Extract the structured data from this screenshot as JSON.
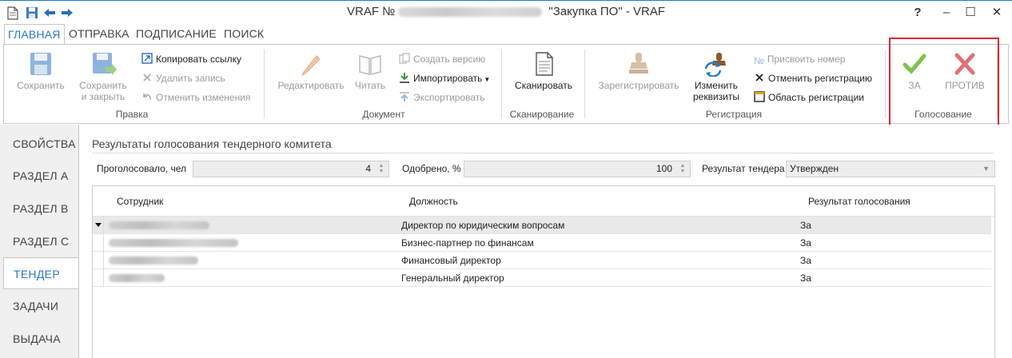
{
  "window": {
    "title_prefix": "VRAF №",
    "title_suffix": " \"Закупка ПО\" - VRAF",
    "help_label": "?",
    "minimize_label": "–",
    "maximize_label": "☐",
    "close_label": "✕"
  },
  "ribbon_tabs": [
    {
      "label": "ГЛАВНАЯ",
      "active": true
    },
    {
      "label": "ОТПРАВКА"
    },
    {
      "label": "ПОДПИСАНИЕ"
    },
    {
      "label": "ПОИСК"
    }
  ],
  "ribbon": {
    "pravka": {
      "label": "Правка",
      "save": "Сохранить",
      "save_close_1": "Сохранить",
      "save_close_2": "и закрыть",
      "copy_link": "Копировать ссылку",
      "delete_record": "Удалить запись",
      "undo_changes": "Отменить изменения"
    },
    "document": {
      "label": "Документ",
      "edit": "Редактировать",
      "read": "Читать",
      "create_version": "Создать версию",
      "import": "Импортировать",
      "export": "Экспортировать"
    },
    "scan": {
      "label": "Сканирование",
      "scan": "Сканировать"
    },
    "registration": {
      "label": "Регистрация",
      "register": "Зарегистрировать",
      "change_details_1": "Изменить",
      "change_details_2": "реквизиты",
      "assign_number": "Присвоить номер",
      "cancel_registration": "Отменить регистрацию",
      "registration_area": "Область регистрации"
    },
    "voting": {
      "label": "Голосование",
      "for": "ЗА",
      "against": "ПРОТИВ"
    }
  },
  "nav": [
    {
      "label": "СВОЙСТВА"
    },
    {
      "label": "РАЗДЕЛ А"
    },
    {
      "label": "РАЗДЕЛ В"
    },
    {
      "label": "РАЗДЕЛ С"
    },
    {
      "label": "ТЕНДЕР",
      "active": true
    },
    {
      "label": "ЗАДАЧИ"
    },
    {
      "label": "ВЫДАЧА"
    }
  ],
  "tender": {
    "section_title": "Результаты голосования тендерного комитета",
    "voted_label": "Проголосовало, чел",
    "voted_value": "4",
    "approved_label": "Одобрено, %",
    "approved_value": "100",
    "result_label": "Результат тендера",
    "result_value": "Утвержден"
  },
  "grid": {
    "headers": {
      "employee": "Сотрудник",
      "position": "Должность",
      "result": "Результат голосования"
    },
    "rows": [
      {
        "position": "Директор по юридическим вопросам",
        "result": "За"
      },
      {
        "position": "Бизнес-партнер по финансам",
        "result": "За"
      },
      {
        "position": "Финансовый директор",
        "result": "За"
      },
      {
        "position": "Генеральный директор",
        "result": "За"
      }
    ]
  },
  "colors": {
    "accent": "#2b78c6",
    "highlight": "#d62b36",
    "vote_for": "#7cc34a",
    "vote_against": "#e07070"
  }
}
